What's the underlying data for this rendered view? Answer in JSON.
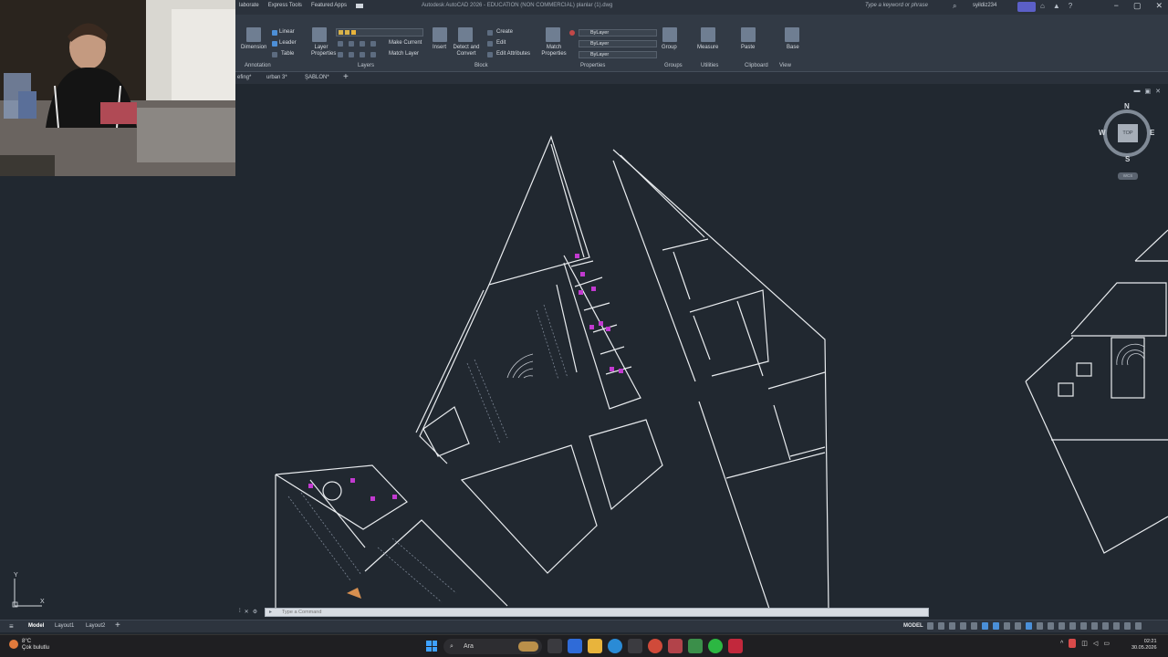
{
  "titlebar": {
    "tabs": [
      "laborate",
      "Express Tools",
      "Featured Apps"
    ],
    "title": "Autodesk AutoCAD 2026 - EDUCATION (NON COMMERCIAL)   planlar (1).dwg",
    "search_placeholder": "Type a keyword or phrase",
    "user": "syildiz234"
  },
  "ribbon": {
    "annotation": {
      "dimension": "Dimension",
      "linear": "Linear",
      "leader": "Leader",
      "table": "Table",
      "panel": "Annotation"
    },
    "layers": {
      "layer_properties": "Layer Properties",
      "make_current": "Make Current",
      "match_layer": "Match Layer",
      "panel": "Layers"
    },
    "block": {
      "insert": "Insert",
      "detect_convert": "Detect and Convert",
      "create": "Create",
      "edit": "Edit",
      "edit_attributes": "Edit Attributes",
      "panel": "Block"
    },
    "properties": {
      "match_properties": "Match Properties",
      "color": "ByLayer",
      "linetype": "ByLayer",
      "lineweight": "ByLayer",
      "panel": "Properties"
    },
    "groups": {
      "group": "Group",
      "panel": "Groups"
    },
    "utilities": {
      "measure": "Measure",
      "panel": "Utilities"
    },
    "clipboard": {
      "paste": "Paste",
      "panel": "Clipboard"
    },
    "view": {
      "base": "Base",
      "panel": "View"
    }
  },
  "file_tabs": [
    "efing*",
    "urban 3*",
    "ŞABLON*"
  ],
  "viewcube": {
    "n": "N",
    "s": "S",
    "e": "E",
    "w": "W",
    "top": "TOP",
    "wcs": "WCS"
  },
  "ucs": {
    "x": "X",
    "y": "Y"
  },
  "command": {
    "placeholder": "Type a Command"
  },
  "statusbar": {
    "tabs": [
      "Model",
      "Layout1",
      "Layout2"
    ],
    "model_label": "MODEL"
  },
  "taskbar": {
    "weather_temp": "8°C",
    "weather_desc": "Çok bulutlu",
    "search": "Ara",
    "time": "02:21",
    "date": "30.05.2026"
  }
}
